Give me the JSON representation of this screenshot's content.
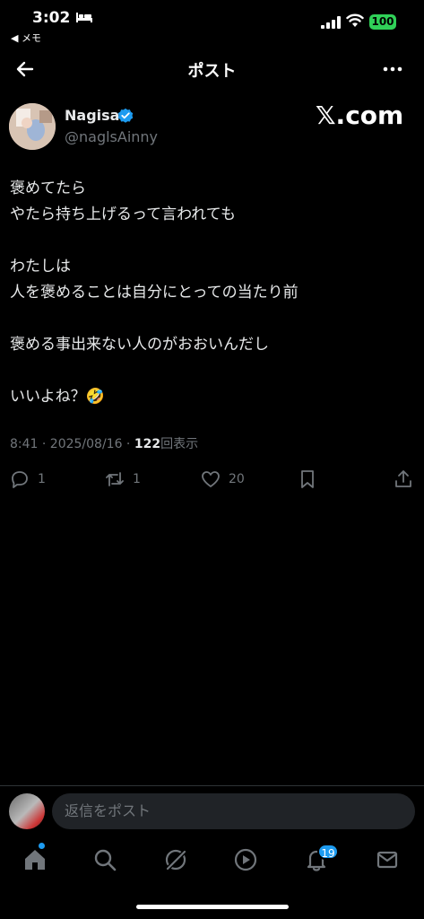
{
  "status_bar": {
    "time": "3:02",
    "back_app": "◀ メモ",
    "battery": "100"
  },
  "header": {
    "title": "ポスト"
  },
  "post": {
    "author_name": "Nagisa",
    "handle": "@naglsAinny",
    "brand": "𝕏.com",
    "text": "褒めてたら\nやたら持ち上げるって言われても\n\nわたしは\n人を褒めることは自分にとっての当たり前\n\n褒める事出来ない人のがおおいんだし\n\nいいよね？🤣",
    "time": "8:41 · 2025/08/16 · ",
    "views_count": "122",
    "views_label": "回表示",
    "actions": {
      "reply_count": "1",
      "repost_count": "1",
      "like_count": "20"
    }
  },
  "reply_bar": {
    "placeholder": "返信をポスト"
  },
  "tab_bar": {
    "notifications_badge": "19"
  },
  "colors": {
    "accent": "#1d9bf0",
    "secondary_text": "#71767b",
    "background": "#000000",
    "battery": "#30d158"
  }
}
